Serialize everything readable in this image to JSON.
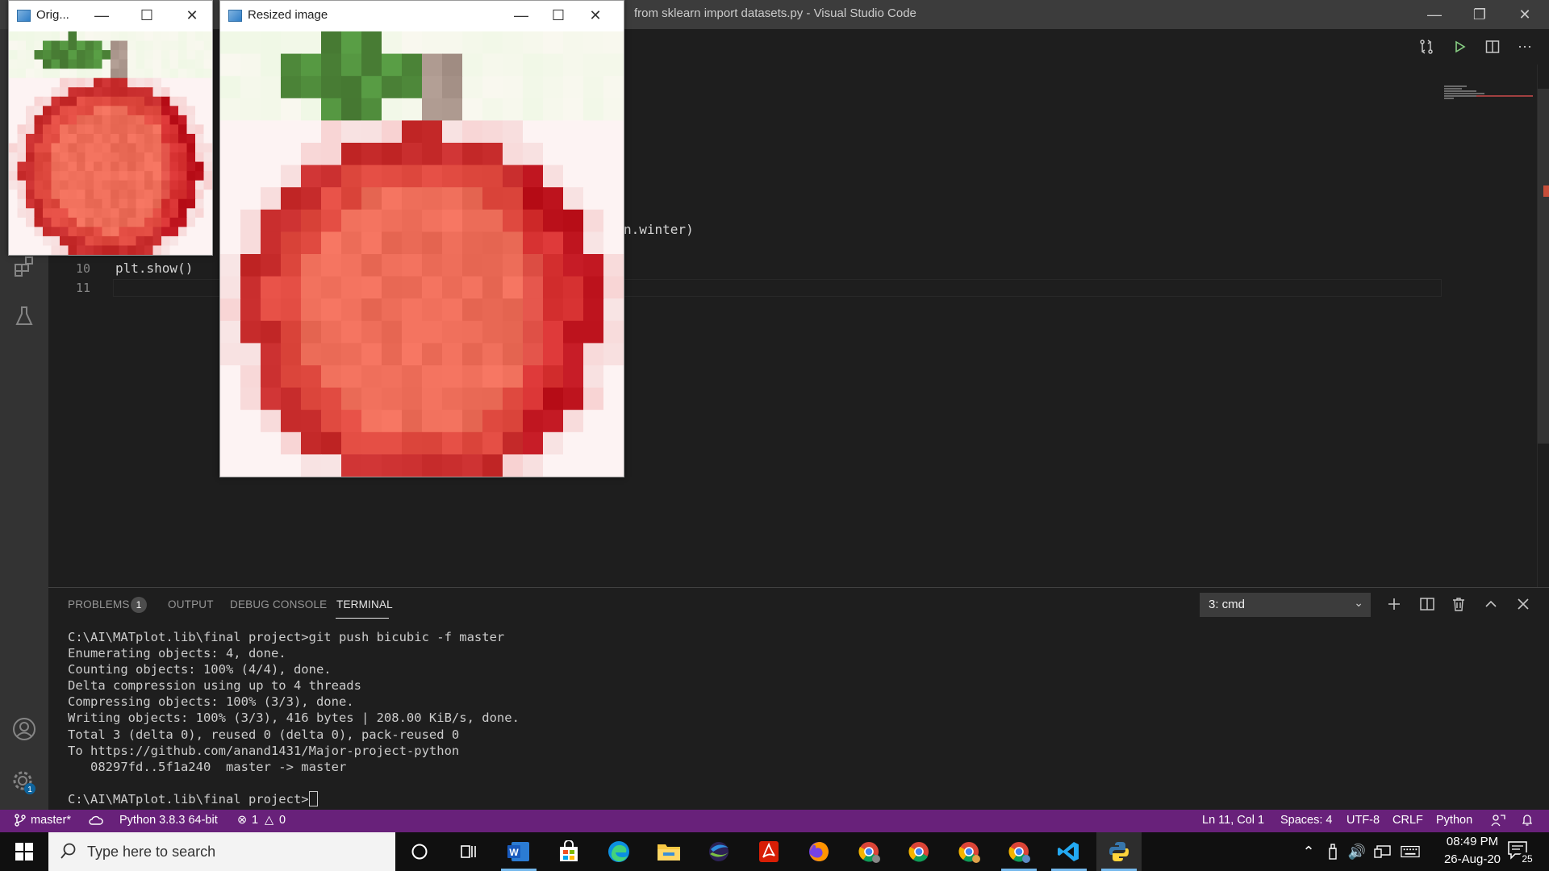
{
  "vscode": {
    "title": "from sklearn import datasets.py - Visual Studio Code",
    "editor_fragment": "n.winter)",
    "lines": [
      {
        "num": "10",
        "code": "plt.show()"
      },
      {
        "num": "11",
        "code": ""
      }
    ]
  },
  "panel": {
    "tabs": {
      "problems": "PROBLEMS",
      "problems_count": "1",
      "output": "OUTPUT",
      "debug_console": "DEBUG CONSOLE",
      "terminal": "TERMINAL"
    },
    "terminal_select": "3: cmd",
    "terminal_lines": [
      "C:\\AI\\MATplot.lib\\final project>git push bicubic -f master",
      "Enumerating objects: 4, done.",
      "Counting objects: 100% (4/4), done.",
      "Delta compression using up to 4 threads",
      "Compressing objects: 100% (3/3), done.",
      "Writing objects: 100% (3/3), 416 bytes | 208.00 KiB/s, done.",
      "Total 3 (delta 0), reused 0 (delta 0), pack-reused 0",
      "To https://github.com/anand1431/Major-project-python",
      "   08297fd..5f1a240  master -> master",
      ""
    ],
    "prompt": "C:\\AI\\MATplot.lib\\final project>"
  },
  "statusbar": {
    "branch": "master*",
    "python": "Python 3.8.3 64-bit",
    "errors": "1",
    "warnings": "0",
    "position": "Ln 11, Col 1",
    "spaces": "Spaces: 4",
    "encoding": "UTF-8",
    "eol": "CRLF",
    "language": "Python"
  },
  "taskbar": {
    "search_placeholder": "Type here to search",
    "time": "08:49 PM",
    "date": "26-Aug-20",
    "notification_count": "25"
  },
  "windows": {
    "original": {
      "title": "Orig..."
    },
    "resized": {
      "title": "Resized image"
    }
  },
  "colors": {
    "statusbar": "#68217a",
    "titlebar": "#3c3c3c",
    "activity_bar": "#333333",
    "editor_bg": "#1e1e1e"
  }
}
